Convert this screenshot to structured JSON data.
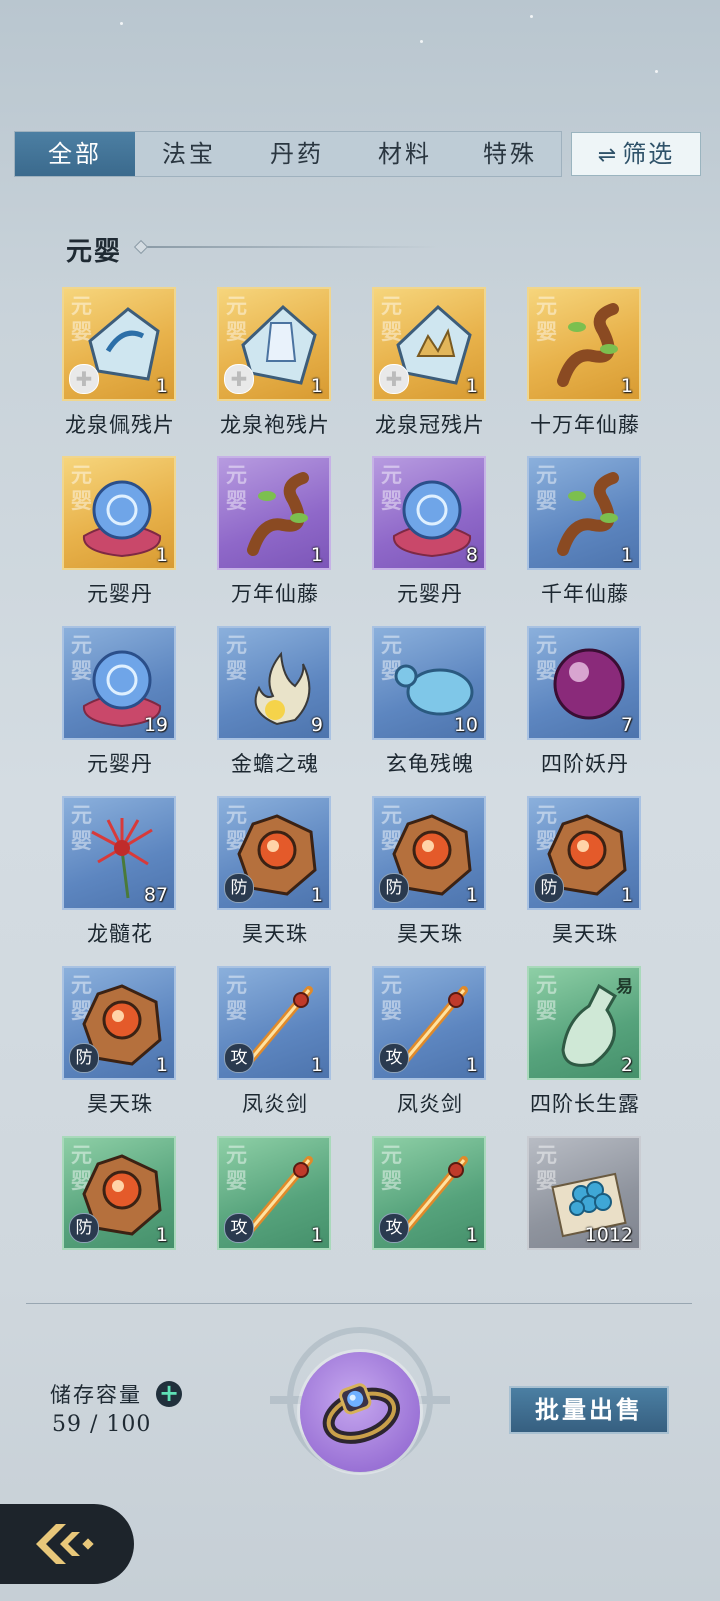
{
  "tabs": [
    {
      "label": "全部",
      "active": true
    },
    {
      "label": "法宝",
      "active": false
    },
    {
      "label": "丹药",
      "active": false
    },
    {
      "label": "材料",
      "active": false
    },
    {
      "label": "特殊",
      "active": false
    }
  ],
  "filter": {
    "label": "筛选",
    "icon": "swap-arrows-icon"
  },
  "section": {
    "title": "元婴"
  },
  "items": [
    {
      "name": "龙泉佩残片",
      "count": "1",
      "rarity": "gold",
      "realm": "元婴",
      "badge": "puzzle",
      "icon": "jade-pendant-fragment-icon"
    },
    {
      "name": "龙泉袍残片",
      "count": "1",
      "rarity": "gold",
      "realm": "元婴",
      "badge": "puzzle",
      "icon": "robe-fragment-icon"
    },
    {
      "name": "龙泉冠残片",
      "count": "1",
      "rarity": "gold",
      "realm": "元婴",
      "badge": "puzzle",
      "icon": "crown-fragment-icon"
    },
    {
      "name": "十万年仙藤",
      "count": "1",
      "rarity": "gold",
      "realm": "元婴",
      "badge": "",
      "icon": "vine-icon"
    },
    {
      "name": "元婴丹",
      "count": "1",
      "rarity": "gold",
      "realm": "元婴",
      "badge": "",
      "icon": "orb-pill-icon"
    },
    {
      "name": "万年仙藤",
      "count": "1",
      "rarity": "purple",
      "realm": "元婴",
      "badge": "",
      "icon": "vine-icon"
    },
    {
      "name": "元婴丹",
      "count": "8",
      "rarity": "purple",
      "realm": "元婴",
      "badge": "",
      "icon": "orb-pill-icon"
    },
    {
      "name": "千年仙藤",
      "count": "1",
      "rarity": "blue",
      "realm": "元婴",
      "badge": "",
      "icon": "vine-icon"
    },
    {
      "name": "元婴丹",
      "count": "19",
      "rarity": "blue",
      "realm": "元婴",
      "badge": "",
      "icon": "orb-pill-icon"
    },
    {
      "name": "金蟾之魂",
      "count": "9",
      "rarity": "blue",
      "realm": "元婴",
      "badge": "",
      "icon": "flame-soul-icon"
    },
    {
      "name": "玄龟残魄",
      "count": "10",
      "rarity": "blue",
      "realm": "元婴",
      "badge": "",
      "icon": "turtle-spirit-icon"
    },
    {
      "name": "四阶妖丹",
      "count": "7",
      "rarity": "blue",
      "realm": "元婴",
      "badge": "",
      "icon": "demon-core-icon"
    },
    {
      "name": "龙髓花",
      "count": "87",
      "rarity": "blue",
      "realm": "元婴",
      "badge": "",
      "icon": "red-flower-icon"
    },
    {
      "name": "昊天珠",
      "count": "1",
      "rarity": "blue",
      "realm": "元婴",
      "badge": "防",
      "icon": "defense-bead-icon"
    },
    {
      "name": "昊天珠",
      "count": "1",
      "rarity": "blue",
      "realm": "元婴",
      "badge": "防",
      "icon": "defense-bead-icon"
    },
    {
      "name": "昊天珠",
      "count": "1",
      "rarity": "blue",
      "realm": "元婴",
      "badge": "防",
      "icon": "defense-bead-icon"
    },
    {
      "name": "昊天珠",
      "count": "1",
      "rarity": "blue",
      "realm": "元婴",
      "badge": "防",
      "icon": "defense-bead-icon"
    },
    {
      "name": "凤炎剑",
      "count": "1",
      "rarity": "blue",
      "realm": "元婴",
      "badge": "攻",
      "icon": "flame-sword-icon"
    },
    {
      "name": "凤炎剑",
      "count": "1",
      "rarity": "blue",
      "realm": "元婴",
      "badge": "攻",
      "icon": "flame-sword-icon"
    },
    {
      "name": "四阶长生露",
      "count": "2",
      "rarity": "green",
      "realm": "元婴",
      "badge": "",
      "tradeable": "易",
      "icon": "elixir-vase-icon"
    },
    {
      "name": "",
      "count": "1",
      "rarity": "green",
      "realm": "元婴",
      "badge": "防",
      "icon": "defense-bead-icon"
    },
    {
      "name": "",
      "count": "1",
      "rarity": "green",
      "realm": "元婴",
      "badge": "攻",
      "icon": "flame-sword-icon"
    },
    {
      "name": "",
      "count": "1",
      "rarity": "green",
      "realm": "元婴",
      "badge": "攻",
      "icon": "flame-sword-icon"
    },
    {
      "name": "",
      "count": "1012",
      "rarity": "gray",
      "realm": "元婴",
      "badge": "",
      "icon": "spirit-stones-icon"
    }
  ],
  "storage": {
    "label": "储存容量",
    "value": "59 / 100"
  },
  "actions": {
    "sell_label": "批量出售",
    "ring_icon": "storage-ring-icon",
    "back_icon": "back-arrow-icon"
  },
  "colors": {
    "gold": "#e8b24b",
    "purple": "#8f68c9",
    "blue": "#5d86c0",
    "green": "#56a37c",
    "gray": "#8f949e",
    "accent": "#3b6a8d"
  }
}
